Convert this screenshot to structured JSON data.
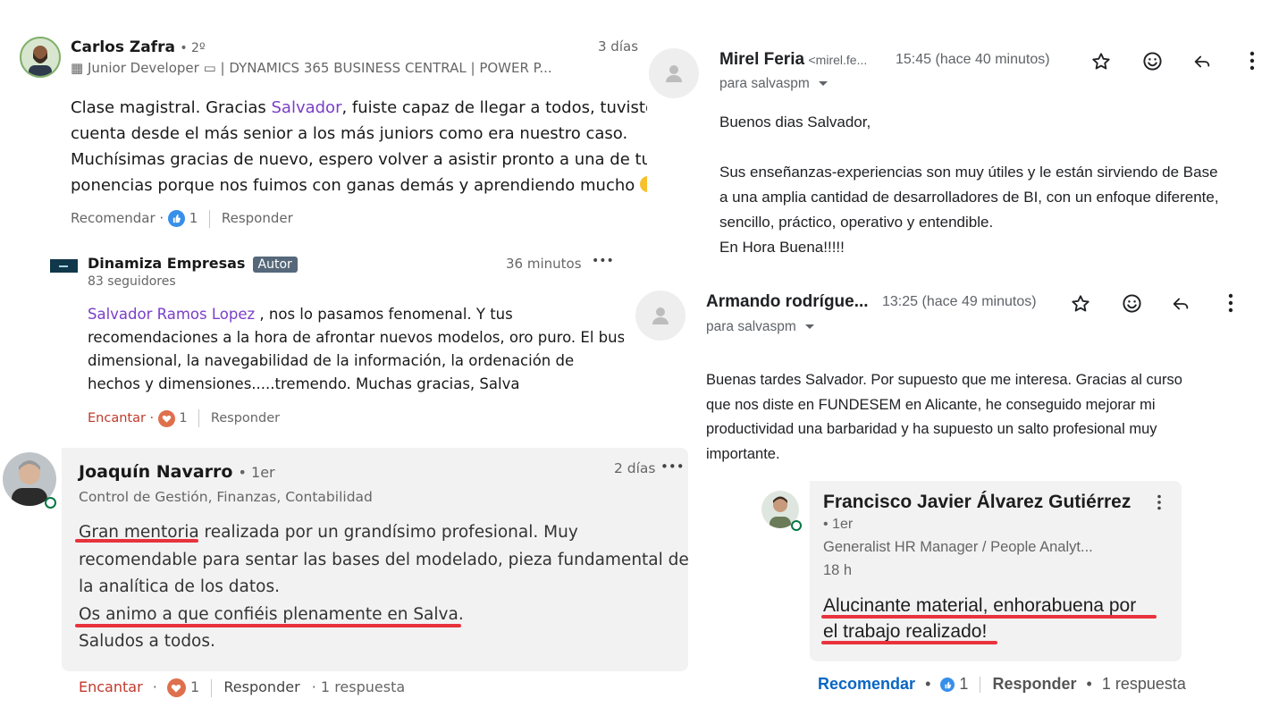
{
  "carlos": {
    "name": "Carlos Zafra",
    "degree": "• 2º",
    "headline": "▦ Junior Developer ▭ | DYNAMICS 365 BUSINESS CENTRAL | POWER P...",
    "time": "3 días",
    "body_pre": "Clase magistral. Gracias ",
    "mention": "Salvador",
    "body_l1_post": ", fuiste capaz de llegar a todos, tuviste en",
    "body_l2": "cuenta desde el más senior a los más juniors como era nuestro caso.",
    "body_l3": "Muchísimas gracias de nuevo, espero volver a asistir pronto a una de tus",
    "body_l4": "ponencias porque nos fuimos con ganas demás y aprendiendo mucho",
    "action_like": "Recomendar ·",
    "like_count": "1",
    "action_reply": "Responder"
  },
  "dinamiza": {
    "name": "Dinamiza Empresas",
    "badge": "Autor",
    "followers": "83 seguidores",
    "time": "36 minutos",
    "more": "•••",
    "mention": "Salvador Ramos Lopez",
    "body_l1_post": " , nos lo pasamos fenomenal. Y tus",
    "body_l2": "recomendaciones a la hora de afrontar nuevos modelos, oro puro. El bus",
    "body_l3": "dimensional, la navegabilidad de la información, la ordenación de",
    "body_l4": "hechos y dimensiones.....tremendo. Muchas gracias, Salva",
    "action_love": "Encantar ·",
    "love_count": "1",
    "action_reply": "Responder"
  },
  "joaquin": {
    "name": "Joaquín Navarro",
    "degree": "• 1er",
    "headline": "Control de Gestión, Finanzas, Contabilidad",
    "time": "2 días",
    "more": "•••",
    "l1": "Gran mentoria realizada por un grandísimo profesional. Muy",
    "l2": "recomendable para sentar las bases del modelado, pieza fundamental de",
    "l3": "la analítica de los datos.",
    "l4": "Os animo a que confiéis plenamente en Salva.",
    "l5": "Saludos a todos.",
    "action_love": "Encantar",
    "dot": "·",
    "love_count": "1",
    "action_reply": "Responder",
    "replies": "· 1 respuesta"
  },
  "mirel": {
    "name": "Mirel Feria",
    "email": "<mirel.fe...",
    "time": "15:45 (hace 40 minutos)",
    "to": "para salvaspm",
    "l1": "Buenos dias Salvador,",
    "l2": "Sus enseñanzas-experiencias son muy útiles y le están sirviendo de Base",
    "l3": "a una amplia cantidad de desarrolladores de BI, con un enfoque diferente,",
    "l4": "sencillo, práctico, operativo y entendible.",
    "l5": "En Hora Buena!!!!!"
  },
  "armando": {
    "name": "Armando rodrígue...",
    "time": "13:25 (hace 49 minutos)",
    "to": "para salvaspm",
    "l1": "Buenas tardes Salvador. Por supuesto que me interesa. Gracias al curso",
    "l2": "que nos diste en FUNDESEM en Alicante, he conseguido mejorar mi",
    "l3": "productividad una barbaridad y ha supuesto un salto profesional muy",
    "l4": "importante."
  },
  "francisco": {
    "name": "Francisco Javier Álvarez Gutiérrez",
    "degree": "• 1er",
    "headline": "Generalist HR Manager / People Analyt...",
    "time": "18 h",
    "l1": "Alucinante material, enhorabuena por",
    "l2": "el trabajo realizado!",
    "action_like": "Recomendar",
    "dot1": "•",
    "like_count": "1",
    "action_reply": "Responder",
    "dot2": "•",
    "replies": "1 respuesta"
  },
  "colors": {
    "linkedin_blue": "#0a66c2",
    "love_red": "#c0392b",
    "mention_purple": "#7a3fc7",
    "underline_red": "#e8323c",
    "gmail_text": "#202124",
    "comment_bg": "#f2f2f2"
  },
  "icons": [
    "person-icon",
    "star-icon",
    "smiley-icon",
    "reply-arrow-icon",
    "kebab-icon",
    "chevron-down-icon",
    "thumbs-up-icon",
    "heart-icon",
    "emoji-icon"
  ]
}
